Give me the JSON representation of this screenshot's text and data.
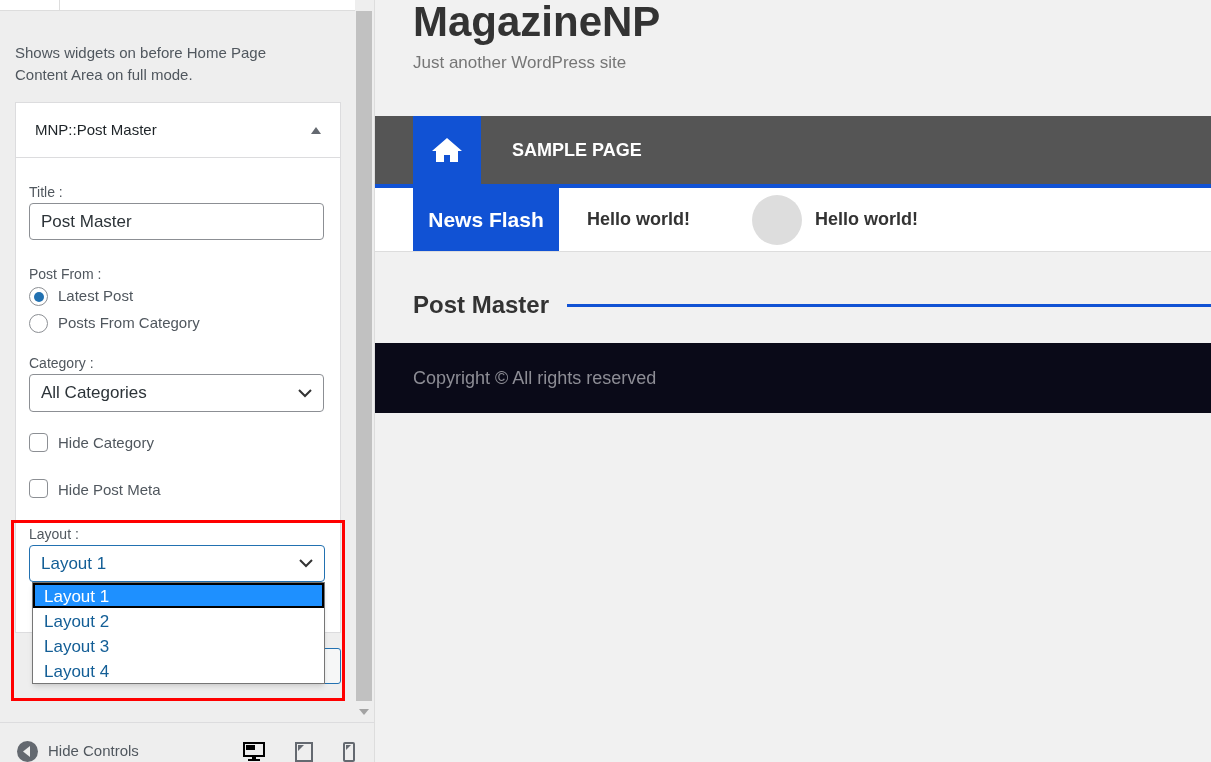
{
  "panel": {
    "description": "Shows widgets on before Home Page Content Area on full mode.",
    "widget": {
      "title": "MNP::Post Master",
      "expanded": true,
      "title_field": {
        "label": "Title :",
        "value": "Post Master"
      },
      "post_from": {
        "label": "Post From :",
        "options": [
          {
            "label": "Latest Post",
            "selected": true
          },
          {
            "label": "Posts From Category",
            "selected": false
          }
        ]
      },
      "category": {
        "label": "Category :",
        "value": "All Categories"
      },
      "checkboxes": [
        {
          "label": "Hide Category",
          "checked": false
        },
        {
          "label": "Hide Post Meta",
          "checked": false
        }
      ],
      "layout": {
        "label": "Layout :",
        "value": "Layout 1",
        "open": true,
        "options": [
          {
            "label": "Layout 1",
            "selected": true
          },
          {
            "label": "Layout 2",
            "selected": false
          },
          {
            "label": "Layout 3",
            "selected": false
          },
          {
            "label": "Layout 4",
            "selected": false
          }
        ]
      }
    },
    "footer": {
      "hide_controls": "Hide Controls",
      "devices": [
        {
          "kind": "desktop",
          "selected": true
        },
        {
          "kind": "tablet",
          "selected": false
        },
        {
          "kind": "mobile",
          "selected": false
        }
      ]
    }
  },
  "site": {
    "title": "MagazineNP",
    "tagline": "Just another WordPress site",
    "nav": [
      {
        "kind": "home",
        "selected": true
      },
      {
        "kind": "link",
        "label": "SAMPLE PAGE",
        "selected": false
      }
    ],
    "news_flash": {
      "label": "News Flash",
      "items": [
        {
          "text": "Hello world!",
          "thumbnail": false
        },
        {
          "text": "Hello world!",
          "thumbnail": true
        }
      ]
    },
    "section_title": "Post Master",
    "copyright": "Copyright © All rights reserved"
  }
}
